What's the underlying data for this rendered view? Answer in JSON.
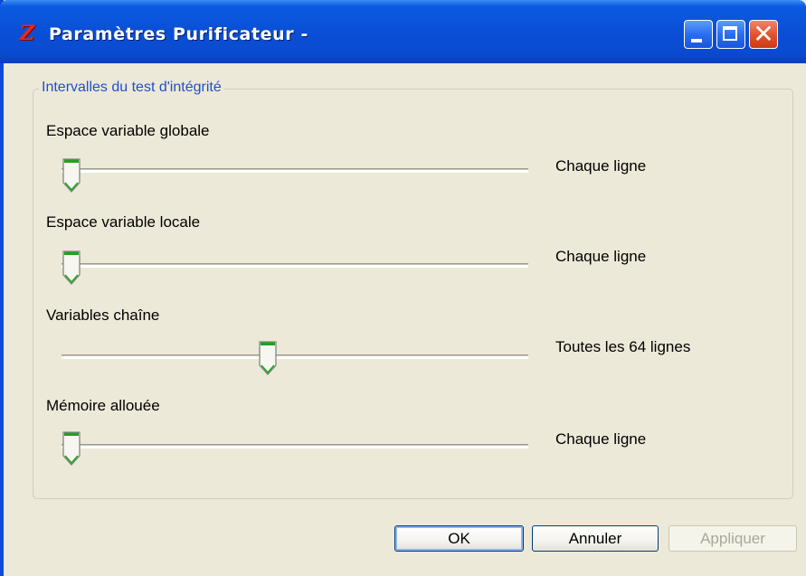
{
  "window": {
    "title": "Paramètres Purificateur -",
    "icon": "z-app-icon",
    "controls": {
      "minimize": "minimize-icon",
      "maximize": "maximize-icon",
      "close": "close-icon",
      "close_glyph": "✕"
    }
  },
  "group": {
    "title": "Intervalles du test d'intégrité"
  },
  "settings": [
    {
      "label": "Espace variable globale",
      "value_text": "Chaque ligne",
      "slider_level": 0.0
    },
    {
      "label": "Espace variable locale",
      "value_text": "Chaque ligne",
      "slider_level": 0.0
    },
    {
      "label": "Variables chaîne",
      "value_text": "Toutes les 64 lignes",
      "slider_level": 0.44
    },
    {
      "label": "Mémoire allouée",
      "value_text": "Chaque ligne",
      "slider_level": 0.0
    }
  ],
  "buttons": {
    "ok": "OK",
    "cancel": "Annuler",
    "apply": "Appliquer"
  },
  "colors": {
    "titlebar": "#0a4fd6",
    "group_title": "#1f4fcf",
    "thumb_accent": "#21a121",
    "close_button": "#e2542e"
  }
}
